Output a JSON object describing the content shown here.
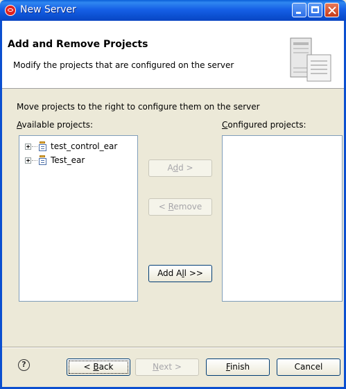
{
  "window": {
    "title": "New Server"
  },
  "header": {
    "title": "Add and Remove Projects",
    "description": "Modify the projects that are configured on the server"
  },
  "instructions": "Move projects to the right to configure them on the server",
  "available": {
    "label_mnemonic": "A",
    "label_rest": "vailable projects:",
    "items": [
      {
        "label": "test_control_ear",
        "icon": "ear-project-icon"
      },
      {
        "label": "Test_ear",
        "icon": "ear-project-icon"
      }
    ]
  },
  "configured": {
    "label_mnemonic": "C",
    "label_rest": "onfigured projects:",
    "items": []
  },
  "buttons": {
    "add": {
      "pre": "A",
      "mnemonic": "d",
      "post": "d >",
      "enabled": false
    },
    "remove": {
      "pre": "< ",
      "mnemonic": "R",
      "post": "emove",
      "enabled": false
    },
    "add_all": {
      "pre": "Add A",
      "mnemonic": "l",
      "post": "l >>",
      "enabled": true
    }
  },
  "footer": {
    "help": "?",
    "back": {
      "pre": "< ",
      "mnemonic": "B",
      "post": "ack",
      "enabled": true
    },
    "next": {
      "pre": "",
      "mnemonic": "N",
      "post": "ext >",
      "enabled": false
    },
    "finish": {
      "pre": "",
      "mnemonic": "F",
      "post": "inish",
      "enabled": true
    },
    "cancel": {
      "label": "Cancel",
      "enabled": true
    }
  },
  "colors": {
    "title_bar": "#0b4fd0",
    "dialog_bg": "#ece9d8",
    "list_border": "#7f9db9",
    "disabled_text": "#a7a6aa"
  }
}
